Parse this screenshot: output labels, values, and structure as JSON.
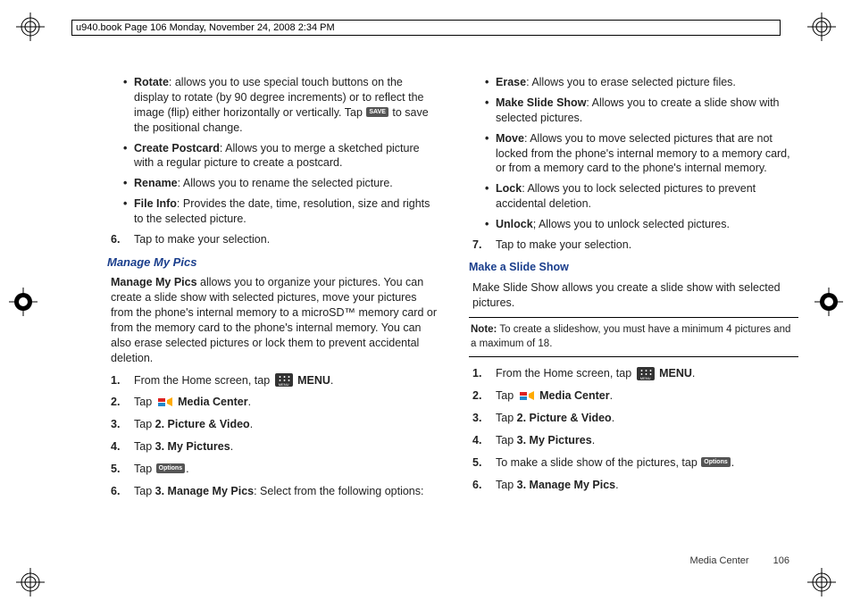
{
  "header": "u940.book  Page 106  Monday, November 24, 2008  2:34 PM",
  "left": {
    "bullets": [
      {
        "term": "Rotate",
        "desc_a": ": allows you to use special touch buttons on the display to rotate (by 90 degree increments) or to reflect the image (flip) either horizontally or vertically. Tap ",
        "btn": "SAVE",
        "desc_b": " to save the positional change."
      },
      {
        "term": "Create Postcard",
        "desc": ": Allows you to merge a sketched picture with a regular picture to create a postcard."
      },
      {
        "term": "Rename",
        "desc": ": Allows you to rename the selected picture."
      },
      {
        "term": "File Info",
        "desc": ": Provides the date, time, resolution, size and rights to the selected picture."
      }
    ],
    "step6": {
      "num": "6.",
      "text": "Tap to make your selection."
    },
    "heading": "Manage My Pics",
    "para_lead": "Manage My Pics",
    "para_rest": " allows you to organize your pictures. You can create a slide show with selected pictures, move your pictures from the phone's internal memory to a microSD™ memory card or from the memory card to the phone's internal memory. You can also erase selected pictures or lock them to prevent accidental deletion.",
    "steps": [
      {
        "num": "1.",
        "a": "From the Home screen, tap ",
        "menu": true,
        "b": " ",
        "bold": "MENU",
        "c": "."
      },
      {
        "num": "2.",
        "a": "Tap ",
        "media": true,
        "b": " ",
        "bold": "Media Center",
        "c": "."
      },
      {
        "num": "3.",
        "a": "Tap ",
        "bold": "2. Picture & Video",
        "c": "."
      },
      {
        "num": "4.",
        "a": "Tap ",
        "bold": "3. My Pictures",
        "c": "."
      },
      {
        "num": "5.",
        "a": "Tap ",
        "btn": "Options",
        "c": "."
      },
      {
        "num": "6.",
        "a": "Tap ",
        "bold": "3. Manage My Pics",
        "c": ": Select from the following options:"
      }
    ]
  },
  "right": {
    "bullets": [
      {
        "term": "Erase",
        "desc": ": Allows you to erase selected picture files."
      },
      {
        "term": "Make Slide Show",
        "desc": ": Allows you to create a slide show with selected pictures."
      },
      {
        "term": "Move",
        "desc": ": Allows you to move selected pictures that are not locked from the phone's internal memory to a memory card, or from a memory card to the phone's internal memory."
      },
      {
        "term": "Lock",
        "desc": ": Allows you to lock selected pictures to prevent accidental deletion."
      },
      {
        "term": "Unlock",
        "desc": "; Allows you to unlock selected pictures."
      }
    ],
    "step7": {
      "num": "7.",
      "text": "Tap to make your selection."
    },
    "heading": "Make a Slide Show",
    "para": "Make Slide Show allows you create a slide show with selected pictures.",
    "note_label": "Note:",
    "note_text": "  To create a slideshow, you must have a minimum 4 pictures and a maximum of 18.",
    "steps": [
      {
        "num": "1.",
        "a": "From the Home screen, tap ",
        "menu": true,
        "b": " ",
        "bold": "MENU",
        "c": "."
      },
      {
        "num": "2.",
        "a": "Tap ",
        "media": true,
        "b": " ",
        "bold": "Media Center",
        "c": "."
      },
      {
        "num": "3.",
        "a": "Tap ",
        "bold": "2. Picture & Video",
        "c": "."
      },
      {
        "num": "4.",
        "a": "Tap ",
        "bold": "3. My Pictures",
        "c": "."
      },
      {
        "num": "5.",
        "a": "To make a slide show of the pictures, tap ",
        "btn": "Options",
        "c": "."
      },
      {
        "num": "6.",
        "a": "Tap ",
        "bold": "3. Manage My Pics",
        "c": "."
      }
    ]
  },
  "footer": {
    "section": "Media Center",
    "page": "106"
  }
}
